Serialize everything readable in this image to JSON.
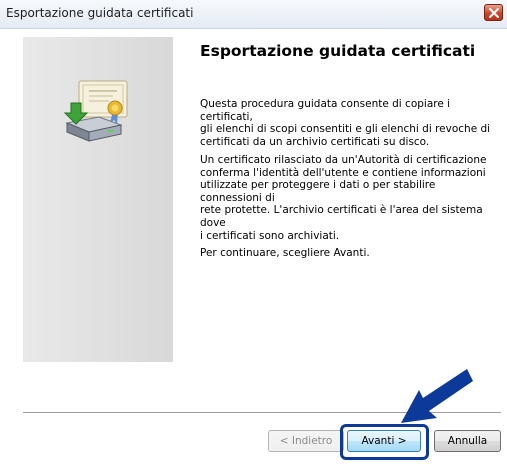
{
  "window": {
    "title": "Esportazione guidata certificati"
  },
  "content": {
    "heading": "Esportazione guidata certificati",
    "paragraph1": "Questa procedura guidata consente di copiare i certificati,\ngli elenchi di scopi consentiti e gli elenchi di revoche di\ncertificati da un archivio certificati su disco.",
    "paragraph2": "Un certificato rilasciato da un'Autorità di certificazione\nconferma l'identità dell'utente e contiene informazioni\nutilizzate per proteggere i dati o per stabilire connessioni di\nrete protette. L'archivio certificati è l'area del sistema dove\ni certificati sono archiviati.",
    "paragraph3": "Per continuare, scegliere Avanti."
  },
  "buttons": {
    "back": "< Indietro",
    "next": "Avanti >",
    "cancel": "Annulla"
  },
  "icons": {
    "wizard": "certificate-export-icon",
    "close": "close-icon",
    "pointer": "arrow-annotation-icon"
  },
  "colors": {
    "annotation": "#0d3a99",
    "close_button": "#c7482d"
  }
}
